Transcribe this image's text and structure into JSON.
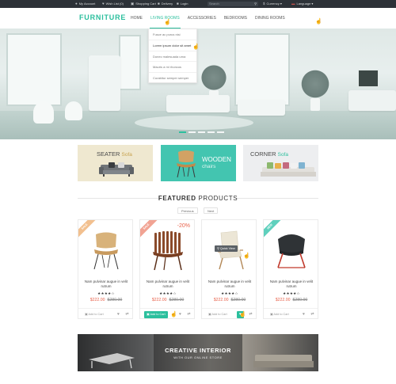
{
  "topbar": {
    "my_account": "My Account",
    "wish_list": "Wish List (0)",
    "shopping_cart": "Shopping Cart",
    "delivery": "Delivery",
    "login": "Login",
    "search_placeholder": "Search",
    "currency": "Currency",
    "language": "Language"
  },
  "header": {
    "logo": "FURNITURE",
    "nav": [
      "HOME",
      "LIVING ROOMS",
      "ACCESSORIES",
      "BEDROOMS",
      "DINING ROOMS"
    ],
    "active_nav": "LIVING ROOMS"
  },
  "dropdown": {
    "items": [
      "Fusce ac purus nisi",
      "Lorem ipsum dolor sit amet",
      "Donec malesuada urna",
      "Mauris a mi rhoncus",
      "Curabitur semper semper"
    ]
  },
  "hero": {
    "slide_count": 5,
    "active_slide": 1
  },
  "categories": [
    {
      "title": "SEATER",
      "subtitle": "Sofa",
      "bg": "#efe8d0"
    },
    {
      "title": "WOODEN",
      "subtitle": "chairs",
      "bg": "#43c5b0"
    },
    {
      "title": "CORNER",
      "subtitle": "Sofa",
      "bg": "#edeef0"
    }
  ],
  "featured": {
    "title_bold": "FEATURED",
    "title_rest": "PRODUCTS",
    "prev_label": "Previous",
    "next_label": "Next"
  },
  "products": [
    {
      "ribbon": "SALE",
      "ribbon_color": "#f2c08f",
      "discount": "",
      "name": "Nam pulvinar augue in velit rutrum",
      "stars": "★★★★☆",
      "price_new": "$222.00",
      "price_old": "$280.00",
      "add_label": "Add to Cart",
      "image": "wooden-chair-image"
    },
    {
      "ribbon": "SALE",
      "ribbon_color": "#f1a393",
      "discount": "-20%",
      "name": "Nam pulvinar augue in velit rutrum",
      "stars": "★★★★☆",
      "price_new": "$222.00",
      "price_old": "$280.00",
      "add_label": "Add to Cart",
      "image": "slatted-chair-image"
    },
    {
      "ribbon": "",
      "ribbon_color": "",
      "discount": "",
      "name": "Nam pulvinar augue in velit rutrum",
      "stars": "★★★★☆",
      "price_new": "$222.00",
      "price_old": "$280.00",
      "add_label": "Add to Cart",
      "quick_view": "Quick View",
      "image": "lounge-chair-image"
    },
    {
      "ribbon": "NEW",
      "ribbon_color": "#5fd0bd",
      "discount": "",
      "name": "Nam pulvinar augue in velit rutrum",
      "stars": "★★★★☆",
      "price_new": "$222.00",
      "price_old": "$280.00",
      "add_label": "Add to Cart",
      "image": "shell-chair-image"
    }
  ],
  "banner": {
    "title": "CREATIVE INTERIOR",
    "subtitle": "WITH OUR ONLINE STORE"
  },
  "colors": {
    "accent": "#2bbf9d",
    "sale": "#e8624b",
    "topbar": "#2d3238"
  }
}
